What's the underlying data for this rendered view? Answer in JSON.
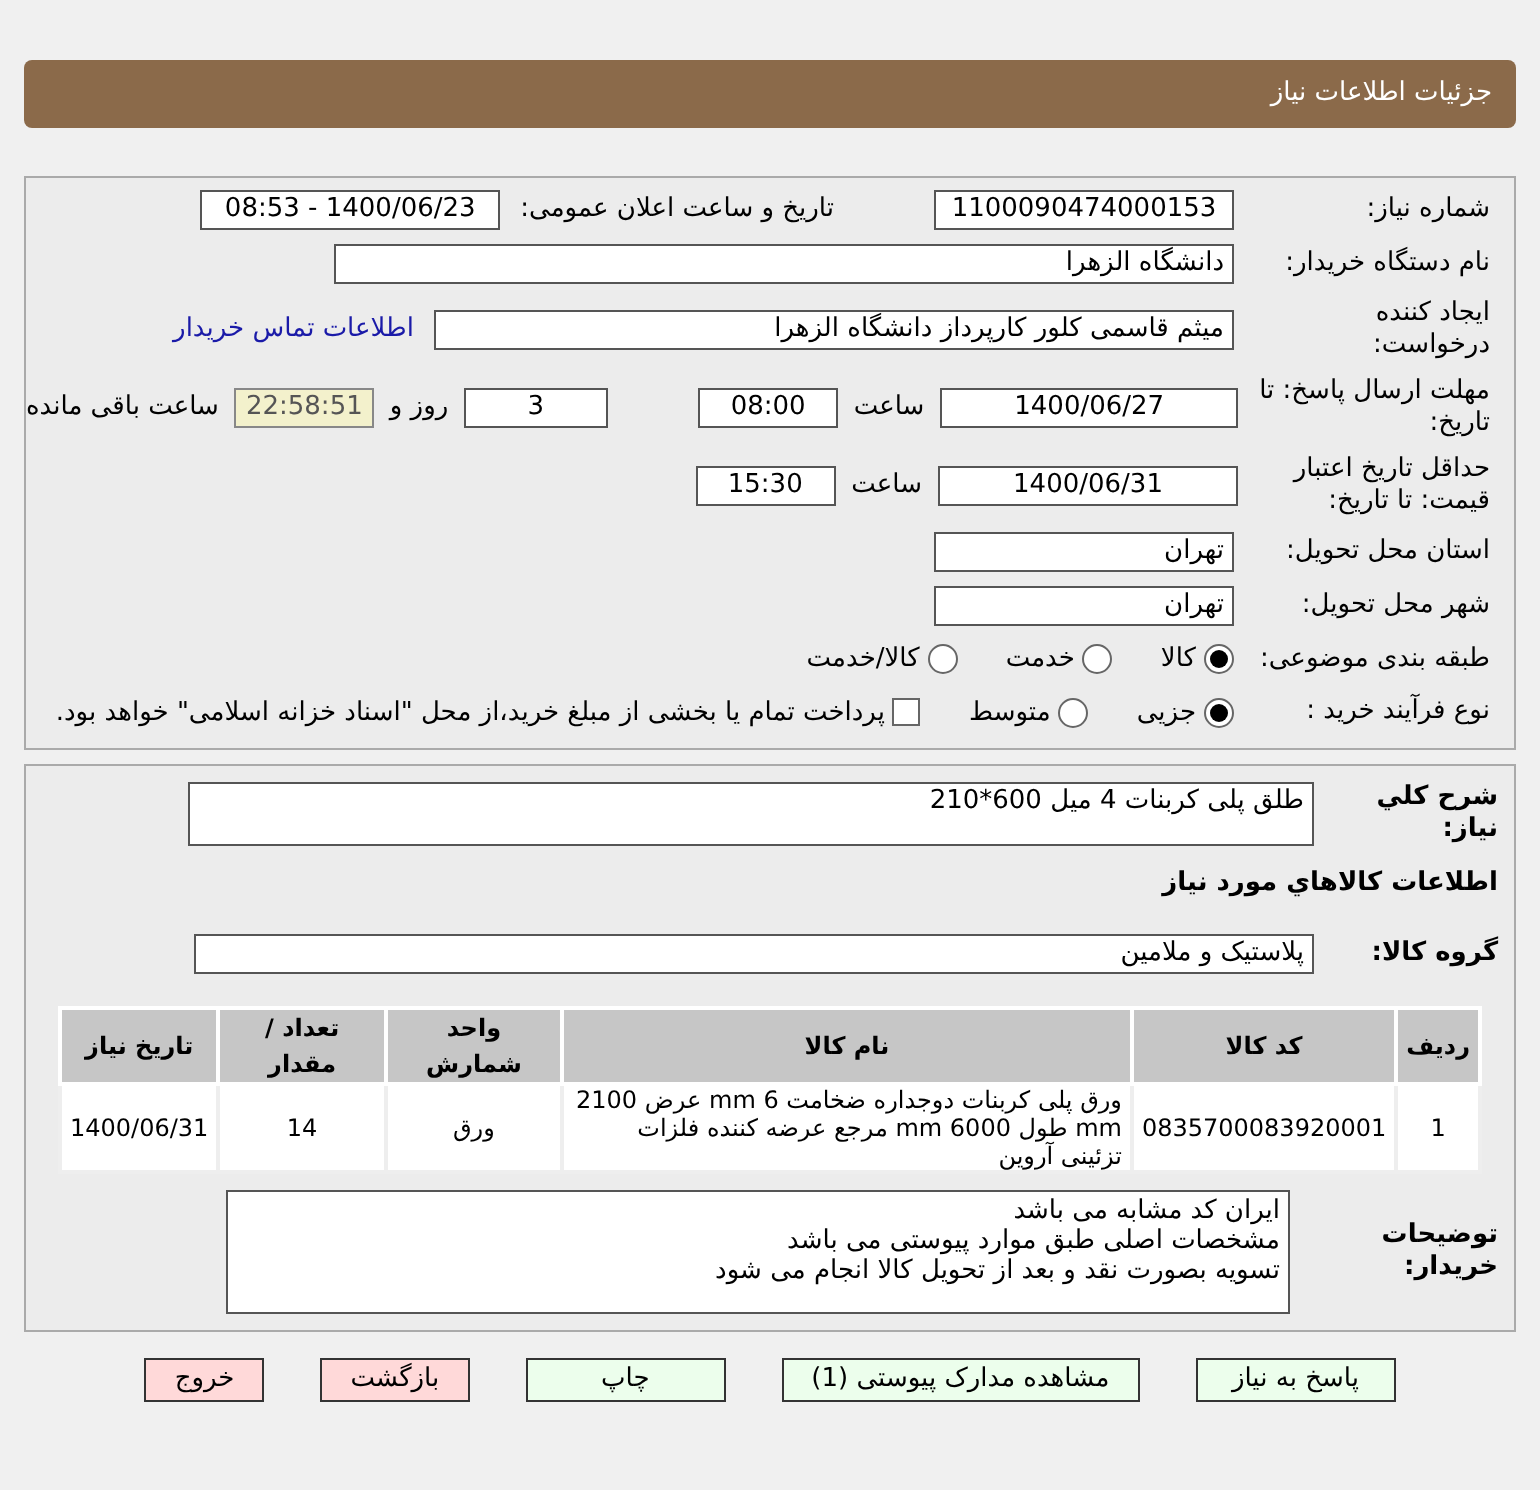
{
  "header": {
    "title": "جزئیات اطلاعات نیاز"
  },
  "need_number": {
    "label": "شماره نیاز:",
    "value": "1100090474000153"
  },
  "announce": {
    "label": "تاریخ و ساعت اعلان عمومی:",
    "value": "1400/06/23 - 08:53"
  },
  "buyer": {
    "label": "نام دستگاه خریدار:",
    "value": "دانشگاه الزهرا"
  },
  "requester": {
    "label": "ایجاد کننده درخواست:",
    "value": "میثم  قاسمی کلور کارپرداز دانشگاه الزهرا",
    "link": "اطلاعات تماس خریدار"
  },
  "deadline": {
    "label": "مهلت ارسال پاسخ: تا تاریخ:",
    "date": "1400/06/27",
    "time_label": "ساعت",
    "time": "08:00",
    "days": "3",
    "days_label": "روز و",
    "remaining": "22:58:51",
    "remaining_label": "ساعت باقی مانده"
  },
  "validity": {
    "label": "حداقل تاریخ اعتبار قیمت: تا تاریخ:",
    "date": "1400/06/31",
    "time_label": "ساعت",
    "time": "15:30"
  },
  "province": {
    "label": "استان محل تحویل:",
    "value": "تهران"
  },
  "city": {
    "label": "شهر محل تحویل:",
    "value": "تهران"
  },
  "category": {
    "label": "طبقه بندی موضوعی:",
    "options": [
      {
        "label": "کالا",
        "selected": true
      },
      {
        "label": "خدمت",
        "selected": false
      },
      {
        "label": "کالا/خدمت",
        "selected": false
      }
    ]
  },
  "process": {
    "label": "نوع فرآیند خرید :",
    "options": [
      {
        "label": "جزیی",
        "selected": true
      },
      {
        "label": "متوسط",
        "selected": false
      }
    ],
    "treasury": {
      "label": "پرداخت تمام یا بخشی از مبلغ خرید،از محل \"اسناد خزانه اسلامی\" خواهد بود.",
      "checked": false
    }
  },
  "summary": {
    "label": "شرح کلي نياز:",
    "value": "طلق پلی کربنات 4 میل 600*210"
  },
  "goods_heading": "اطلاعات کالاهاي مورد نياز",
  "goods_group": {
    "label": "گروه کالا:",
    "value": "پلاستیک و ملامین"
  },
  "table": {
    "columns": [
      "ردیف",
      "کد کالا",
      "نام کالا",
      "واحد شمارش",
      "تعداد / مقدار",
      "تاریخ نیاز"
    ],
    "rows": [
      [
        "1",
        "0835700083920001",
        "ورق پلی کربنات دوجداره ضخامت 6 mm عرض 2100 mm طول 6000 mm مرجع عرضه کننده فلزات تزئینی آروین",
        "ورق",
        "14",
        "1400/06/31"
      ]
    ]
  },
  "notes": {
    "label": "توضیحات خریدار:",
    "lines": [
      "ایران کد مشابه می باشد",
      "مشخصات اصلی طبق موارد پیوستی می باشد",
      "تسویه بصورت نقد و بعد از تحویل کالا انجام می شود"
    ]
  },
  "buttons": [
    {
      "label": "پاسخ به نیاز",
      "kind": "normal"
    },
    {
      "label": "مشاهده مدارک پیوستی (1)",
      "kind": "normal"
    },
    {
      "label": "چاپ",
      "kind": "normal"
    },
    {
      "label": "بازگشت",
      "kind": "danger"
    },
    {
      "label": "خروج",
      "kind": "danger"
    }
  ]
}
